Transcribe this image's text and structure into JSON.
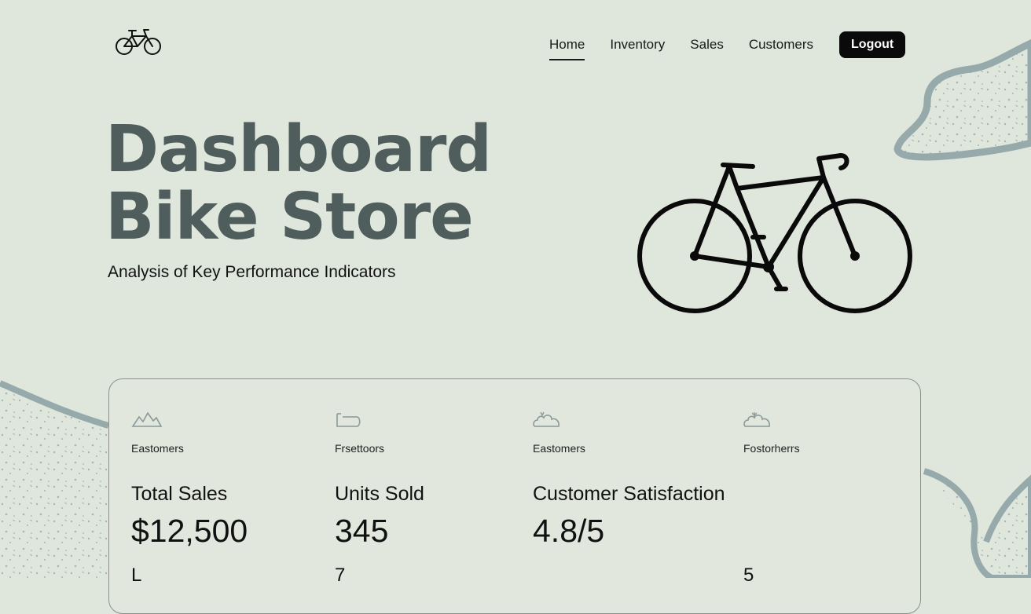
{
  "header": {
    "logo_icon": "bicycle-icon",
    "nav": [
      {
        "label": "Home",
        "active": true
      },
      {
        "label": "Inventory",
        "active": false
      },
      {
        "label": "Sales",
        "active": false
      },
      {
        "label": "Customers",
        "active": false
      }
    ],
    "logout_label": "Logout"
  },
  "hero": {
    "title_line1": "Dashboard",
    "title_line2": "Bike Store",
    "subtitle": "Analysis of Key Performance Indicators",
    "illustration_icon": "road-bike-icon"
  },
  "kpis": [
    {
      "icon": "mountain-icon",
      "caption": "Eastomers",
      "label": "Total Sales",
      "value": "$12,500",
      "extra": "L"
    },
    {
      "icon": "box-icon",
      "caption": "Frsettoors",
      "label": "Units Sold",
      "value": "345",
      "extra": "7"
    },
    {
      "icon": "cloud-icon",
      "caption": "Eastomers",
      "label": "Customer Satisfaction",
      "value": "4.8/5",
      "extra": ""
    },
    {
      "icon": "cloud-sprout-icon",
      "caption": "Fostorherrs",
      "label": "",
      "value": "",
      "extra": "5"
    }
  ],
  "colors": {
    "background": "#dfe6dc",
    "title": "#4f5d5c",
    "accent_blob": "#97aaab",
    "button": "#0a0a0a"
  }
}
